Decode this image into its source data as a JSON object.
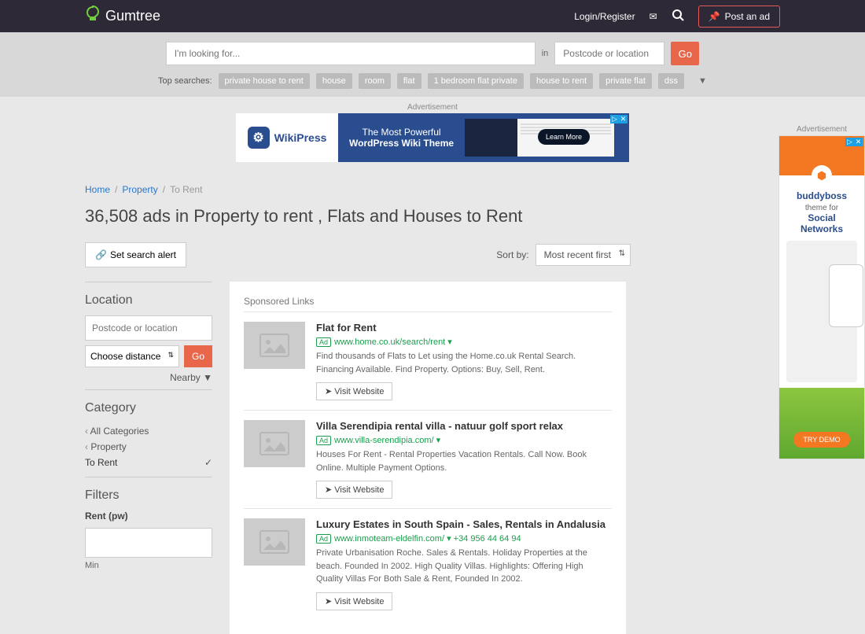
{
  "header": {
    "brand": "Gumtree",
    "login": "Login/Register",
    "post_ad": "Post an ad"
  },
  "search": {
    "placeholder": "I'm looking for...",
    "in": "in",
    "loc_placeholder": "Postcode or location",
    "go": "Go",
    "top_label": "Top searches:",
    "tags": [
      "private house to rent",
      "house",
      "room",
      "flat",
      "1 bedroom flat private",
      "house to rent",
      "private flat",
      "dss"
    ]
  },
  "ads": {
    "label": "Advertisement",
    "banner": {
      "brand": "WikiPress",
      "line1": "The Most Powerful",
      "line2": "WordPress Wiki Theme",
      "cta": "Learn More"
    },
    "side": {
      "brand": "buddyboss",
      "theme": "theme for",
      "line1": "Social",
      "line2": "Networks",
      "cta": "TRY DEMO"
    }
  },
  "breadcrumb": {
    "home": "Home",
    "property": "Property",
    "torent": "To Rent"
  },
  "title": "36,508 ads in Property to rent , Flats and Houses to Rent",
  "alert": "Set search alert",
  "sort": {
    "label": "Sort by:",
    "value": "Most recent first"
  },
  "sidebar": {
    "location": {
      "title": "Location",
      "placeholder": "Postcode or location",
      "distance": "Choose distance",
      "go": "Go",
      "nearby": "Nearby"
    },
    "category": {
      "title": "Category",
      "all": "All Categories",
      "property": "Property",
      "torent": "To Rent"
    },
    "filters": {
      "title": "Filters",
      "rent": "Rent (pw)",
      "min": "Min"
    }
  },
  "listings": {
    "sponsored": "Sponsored Links",
    "visit": "Visit Website",
    "items": [
      {
        "title": "Flat for Rent",
        "url": "www.home.co.uk/search/rent ▾",
        "desc": "Find thousands of Flats to Let using the Home.co.uk Rental Search. Financing Available. Find Property. Options: Buy, Sell, Rent."
      },
      {
        "title": "Villa Serendipia rental villa - natuur golf sport relax",
        "url": "www.villa-serendipia.com/ ▾",
        "desc": "Houses For Rent - Rental Properties Vacation Rentals. Call Now. Book Online. Multiple Payment Options."
      },
      {
        "title": "Luxury Estates in South Spain - Sales, Rentals in Andalusia",
        "url": "www.inmoteam-eldelfin.com/ ▾ +34 956 44 64 94",
        "desc": "Private Urbanisation Roche. Sales & Rentals. Holiday Properties at the beach. Founded In 2002. High Quality Villas. Highlights: Offering High Quality Villas For Both Sale & Rent, Founded In 2002."
      }
    ]
  }
}
